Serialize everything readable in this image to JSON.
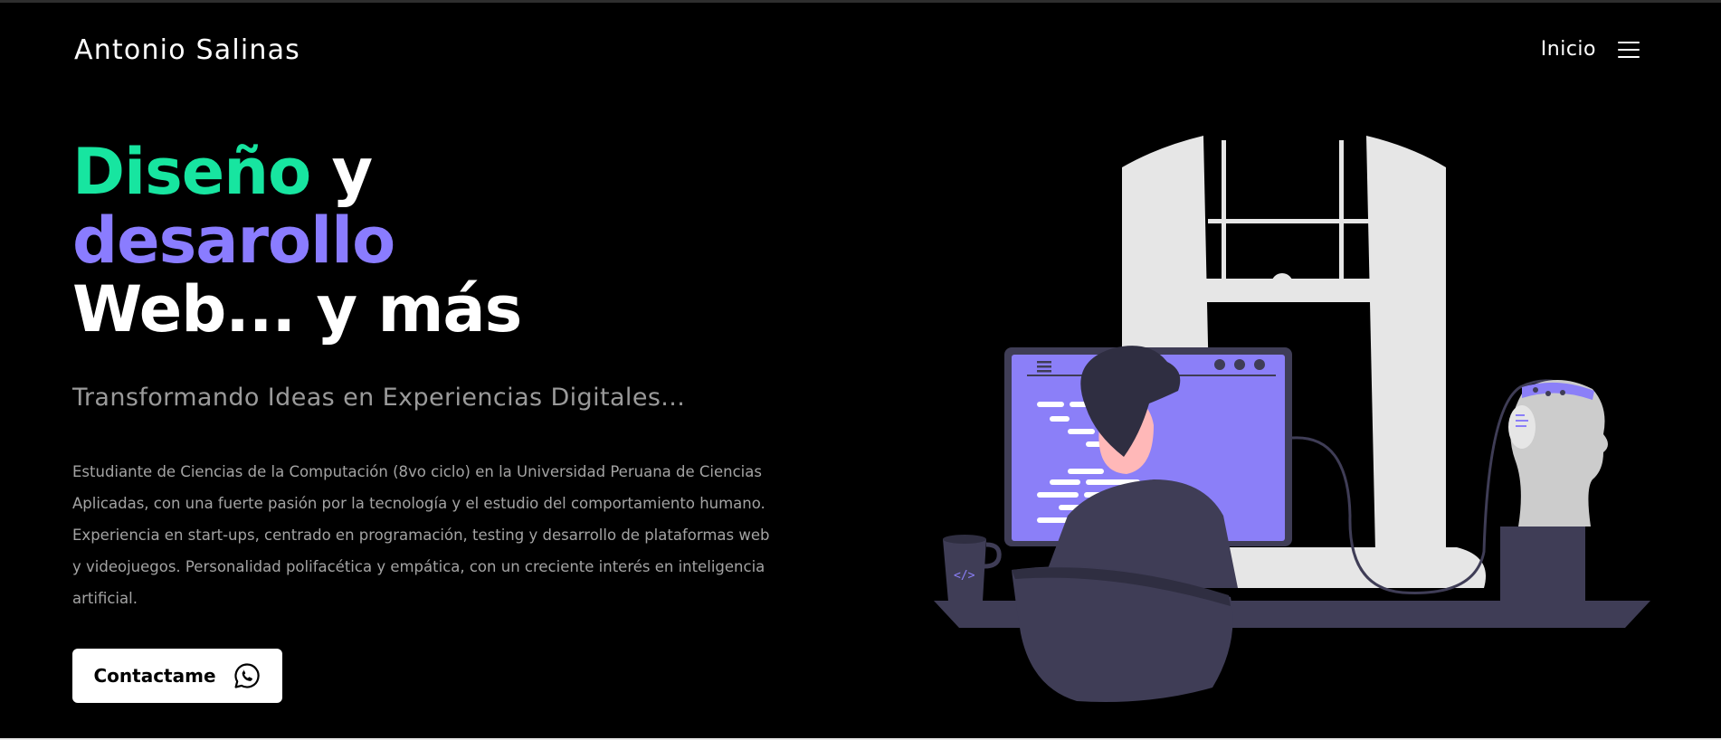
{
  "header": {
    "brand": "Antonio Salinas",
    "nav_link": "Inicio",
    "menu_icon": "hamburger-menu-icon"
  },
  "hero": {
    "headline_part1": "Diseño",
    "headline_part2": " y",
    "headline_part3": "desarollo",
    "headline_part4": "Web... y más",
    "subtitle": "Transformando Ideas en Experiencias Digitales...",
    "description": "Estudiante de Ciencias de la Computación (8vo ciclo) en la Universidad Peruana de Ciencias Aplicadas, con una fuerte pasión por la tecnología y el estudio del comportamiento humano. Experiencia en start-ups, centrado en programación, testing y desarrollo de plataformas web y videojuegos. Personalidad polifacética y empática, con un creciente interés en inteligencia artificial.",
    "cta_label": "Contactame",
    "cta_icon": "whatsapp-icon"
  },
  "colors": {
    "background": "#000000",
    "accent_green": "#17e5a0",
    "accent_purple": "#8a7cff",
    "text_muted": "#a3a3a3",
    "illustration_purple": "#8b7ff8",
    "illustration_dark": "#3f3d56"
  },
  "illustration": {
    "name": "developer-at-desk-illustration",
    "mug_icon": "code-brackets-icon"
  }
}
